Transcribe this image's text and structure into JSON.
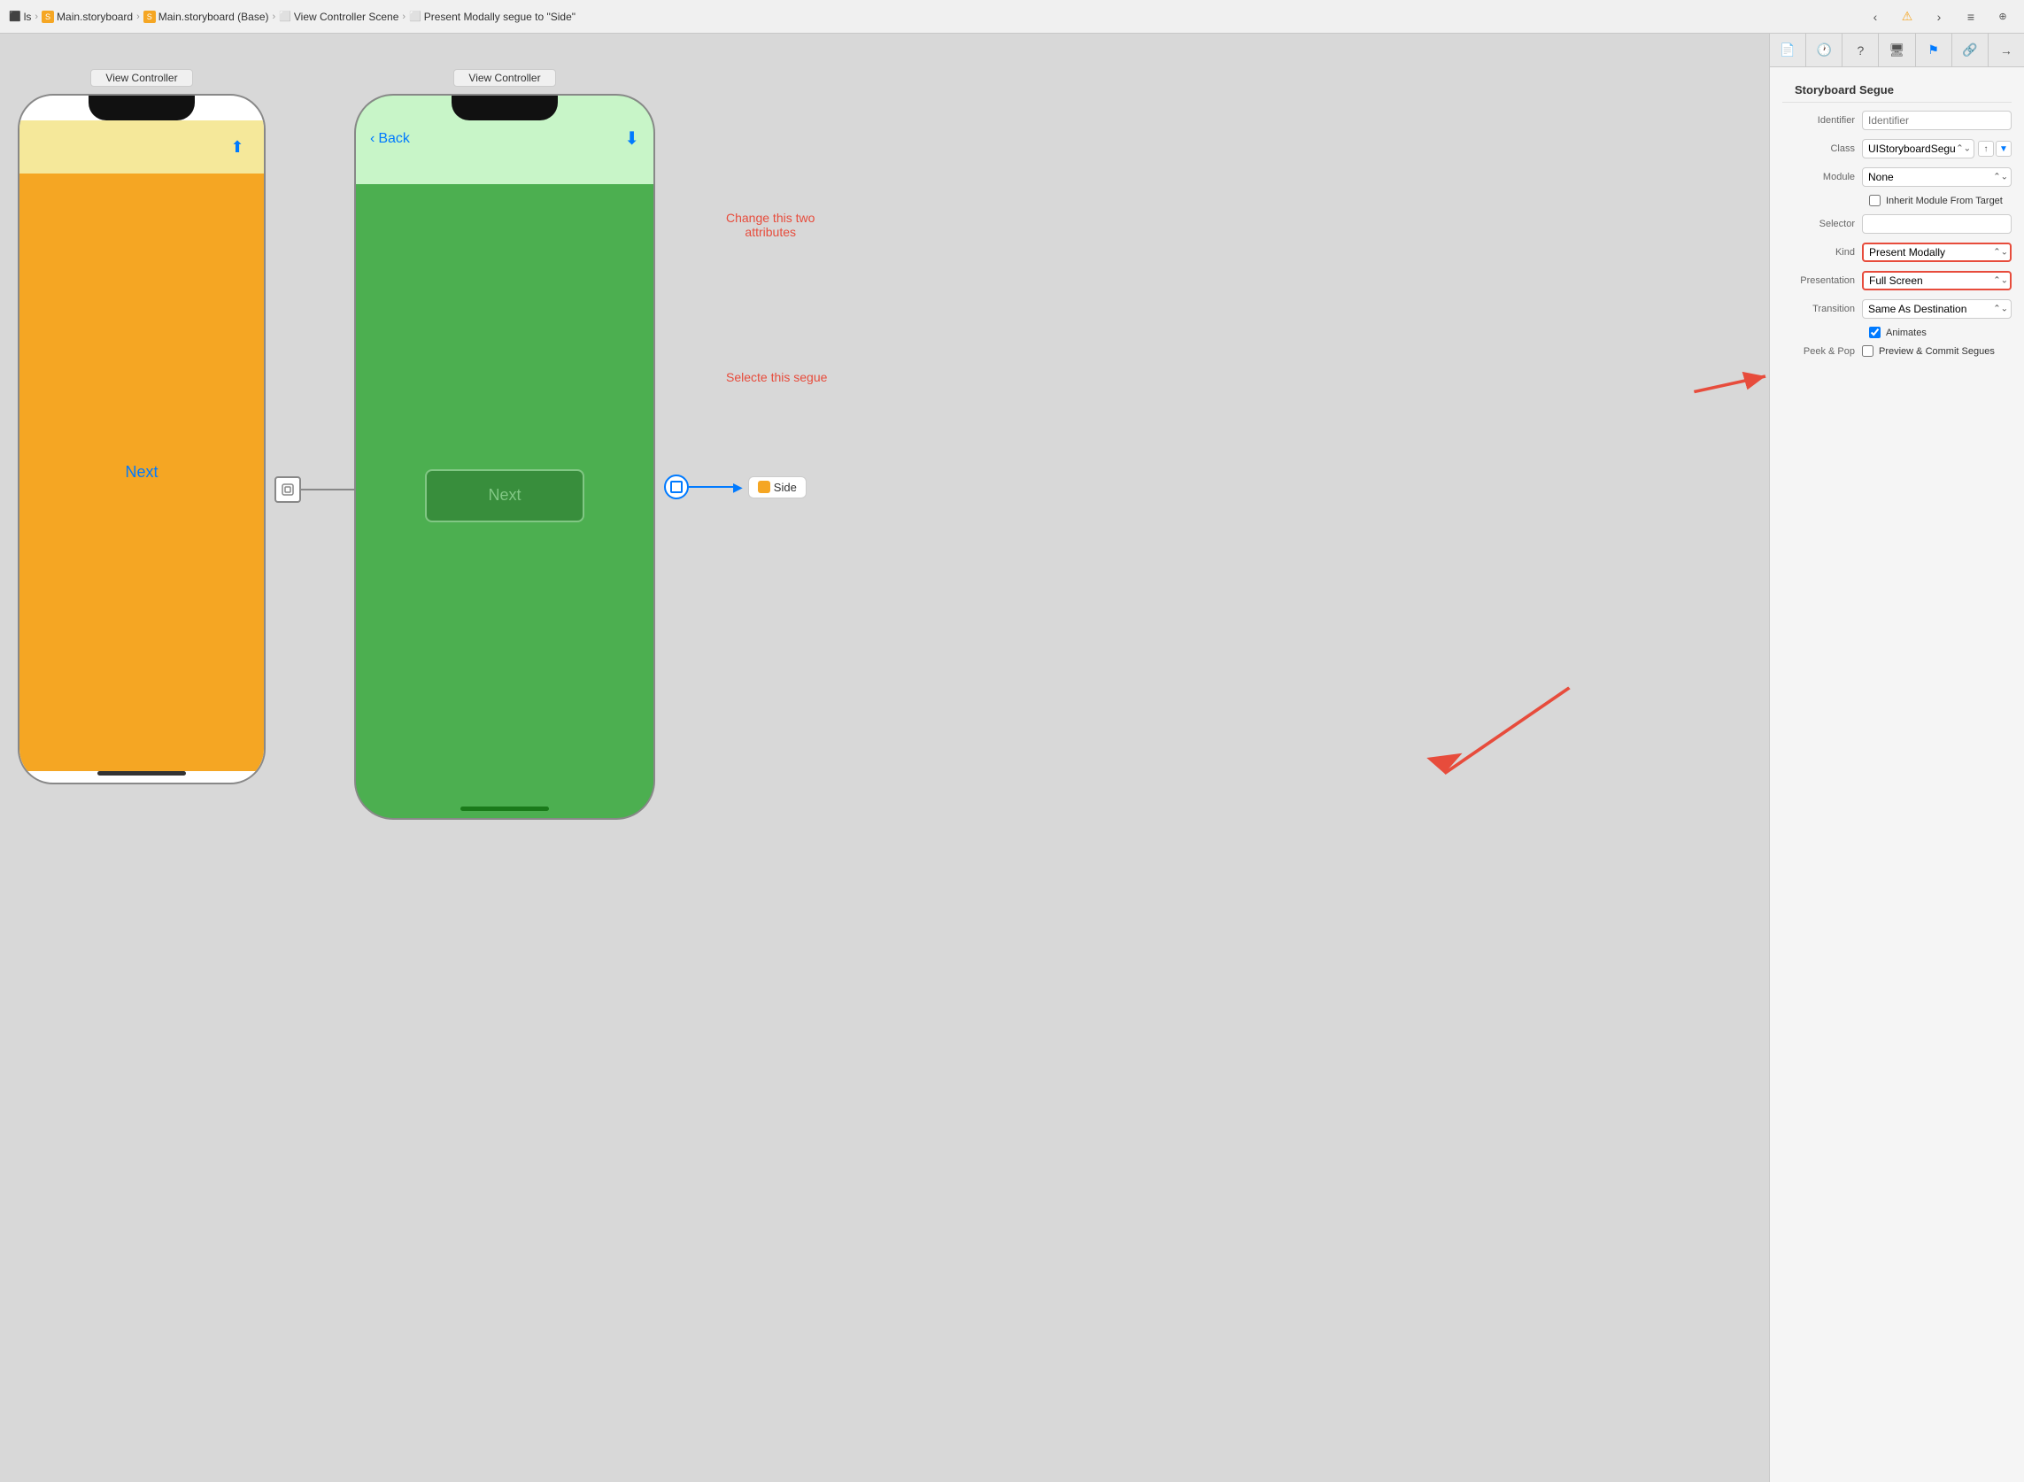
{
  "toolbar": {
    "breadcrumbs": [
      {
        "label": "ls",
        "icon": "folder",
        "color": "#888"
      },
      {
        "label": "Main.storyboard",
        "icon": "storyboard",
        "color": "#f5a623"
      },
      {
        "label": "Main.storyboard (Base)",
        "icon": "storyboard",
        "color": "#f5a623"
      },
      {
        "label": "View Controller Scene",
        "icon": "viewcontroller",
        "color": "#888"
      },
      {
        "label": "Present Modally segue to \"Side\"",
        "icon": "segue",
        "color": "#888"
      }
    ],
    "buttons": [
      "back",
      "warning",
      "forward",
      "list",
      "add"
    ]
  },
  "canvas": {
    "left_phone": {
      "label": "View Controller",
      "next_text": "Next"
    },
    "right_phone": {
      "label": "View Controller",
      "back_text": "Back",
      "next_text": "Next"
    },
    "side_label": "Side",
    "annotation_change": "Change this two\nattributes",
    "annotation_select": "Selecte this segue"
  },
  "right_panel": {
    "title": "Storyboard Segue",
    "fields": {
      "identifier_label": "Identifier",
      "identifier_placeholder": "Identifier",
      "class_label": "Class",
      "class_value": "UIStoryboardSegue",
      "module_label": "Module",
      "module_value": "None",
      "inherit_label": "Inherit Module From Target",
      "selector_label": "Selector",
      "selector_value": "",
      "kind_label": "Kind",
      "kind_value": "Present Modally",
      "presentation_label": "Presentation",
      "presentation_value": "Full Screen",
      "transition_label": "Transition",
      "transition_value": "Same As Destination",
      "animates_label": "Animates",
      "animates_checked": true,
      "peek_pop_label": "Peek & Pop",
      "peek_pop_check_label": "Preview & Commit Segues"
    }
  }
}
